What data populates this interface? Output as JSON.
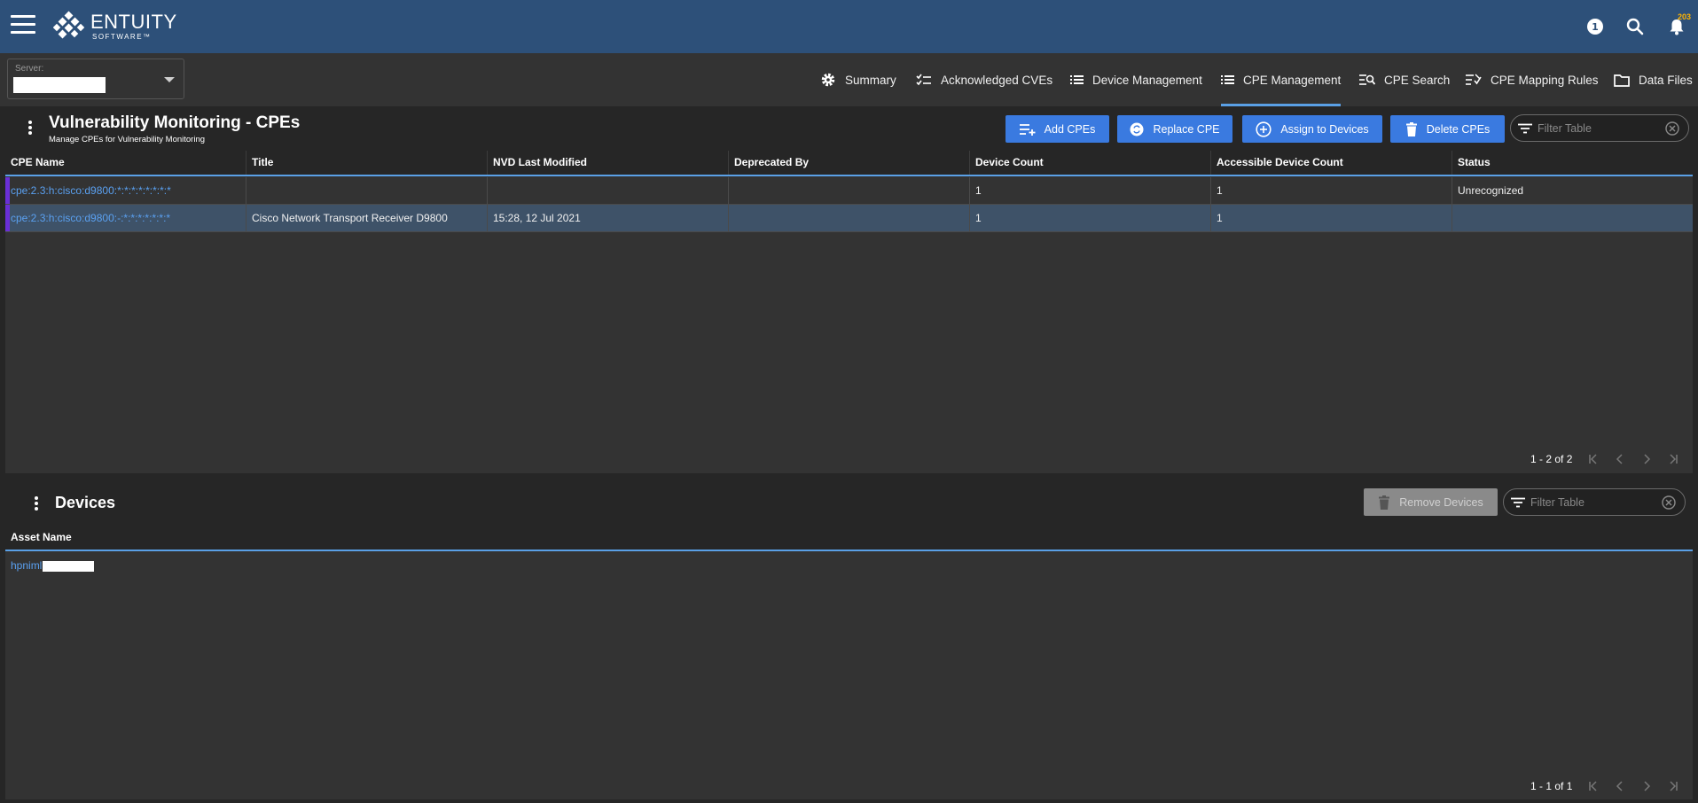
{
  "app": {
    "brand": "ENTUITY",
    "brand_sub": "SOFTWARE™",
    "notification_count": "203"
  },
  "server": {
    "label": "Server:",
    "value": ""
  },
  "tabs": [
    {
      "label": "Summary",
      "icon": "gear-icon"
    },
    {
      "label": "Acknowledged CVEs",
      "icon": "checklist-icon"
    },
    {
      "label": "Device Management",
      "icon": "list-icon"
    },
    {
      "label": "CPE Management",
      "icon": "list-icon",
      "active": true
    },
    {
      "label": "CPE Search",
      "icon": "list-search-icon"
    },
    {
      "label": "CPE Mapping Rules",
      "icon": "list-check-icon"
    },
    {
      "label": "Data Files",
      "icon": "folder-icon"
    }
  ],
  "cpe_panel": {
    "title": "Vulnerability Monitoring - CPEs",
    "subtitle": "Manage CPEs for Vulnerability Monitoring",
    "buttons": {
      "add": "Add CPEs",
      "replace": "Replace CPE",
      "assign": "Assign to Devices",
      "delete": "Delete CPEs"
    },
    "filter_placeholder": "Filter Table",
    "columns": [
      "CPE Name",
      "Title",
      "NVD Last Modified",
      "Deprecated By",
      "Device Count",
      "Accessible Device Count",
      "Status"
    ],
    "rows": [
      [
        "cpe:2.3:h:cisco:d9800:*:*:*:*:*:*:*:*",
        "",
        "",
        "",
        "1",
        "1",
        "Unrecognized"
      ],
      [
        "cpe:2.3:h:cisco:d9800:-:*:*:*:*:*:*:*",
        "Cisco Network Transport Receiver D9800",
        "15:28, 12 Jul 2021",
        "",
        "1",
        "1",
        ""
      ]
    ],
    "pager": "1 - 2 of 2"
  },
  "devices_panel": {
    "title": "Devices",
    "remove_button": "Remove Devices",
    "filter_placeholder": "Filter Table",
    "columns": [
      "Asset Name"
    ],
    "rows": [
      [
        "hpniml"
      ]
    ],
    "pager": "1 - 1 of 1"
  },
  "colors": {
    "topbar": "#2d5079",
    "accent": "#3a7ae0",
    "link": "#5aa0f0",
    "selected_row": "#3e5268",
    "row_marker": "#6a2fd6"
  }
}
